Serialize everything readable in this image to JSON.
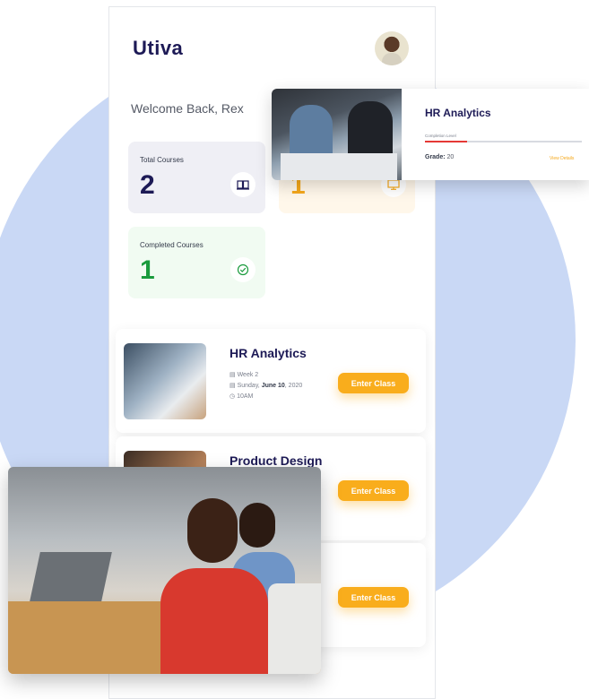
{
  "brand": {
    "logo": "Utiva"
  },
  "header": {
    "welcome": "Welcome Back, Rex"
  },
  "stats": {
    "total": {
      "label": "Total Courses",
      "value": "2"
    },
    "ongoing": {
      "value": "1"
    },
    "completed": {
      "label": "Completed Courses",
      "value": "1"
    }
  },
  "hr_card": {
    "title": "HR Analytics",
    "level_label": "Completion Level",
    "level_fraction": 0.27,
    "grade_label": "Grade:",
    "grade_value": "20",
    "link": "View Details"
  },
  "courses": [
    {
      "title": "HR Analytics",
      "week": "Week 2",
      "day": "Sunday,",
      "date": "June 10",
      "year": ", 2020",
      "time": "10AM",
      "button": "Enter Class"
    },
    {
      "title": "Product Design",
      "button": "Enter Class"
    },
    {
      "button": "Enter Class"
    }
  ],
  "colors": {
    "brand": "#1d1a56",
    "accent": "#f9ad1c",
    "success": "#1a9b3d",
    "background_circle": "#c9d8f5"
  },
  "icons": {
    "total": "book-icon",
    "ongoing": "monitor-icon",
    "completed": "check-circle-icon",
    "week": "calendar-icon",
    "date": "calendar-icon",
    "time": "clock-icon"
  }
}
